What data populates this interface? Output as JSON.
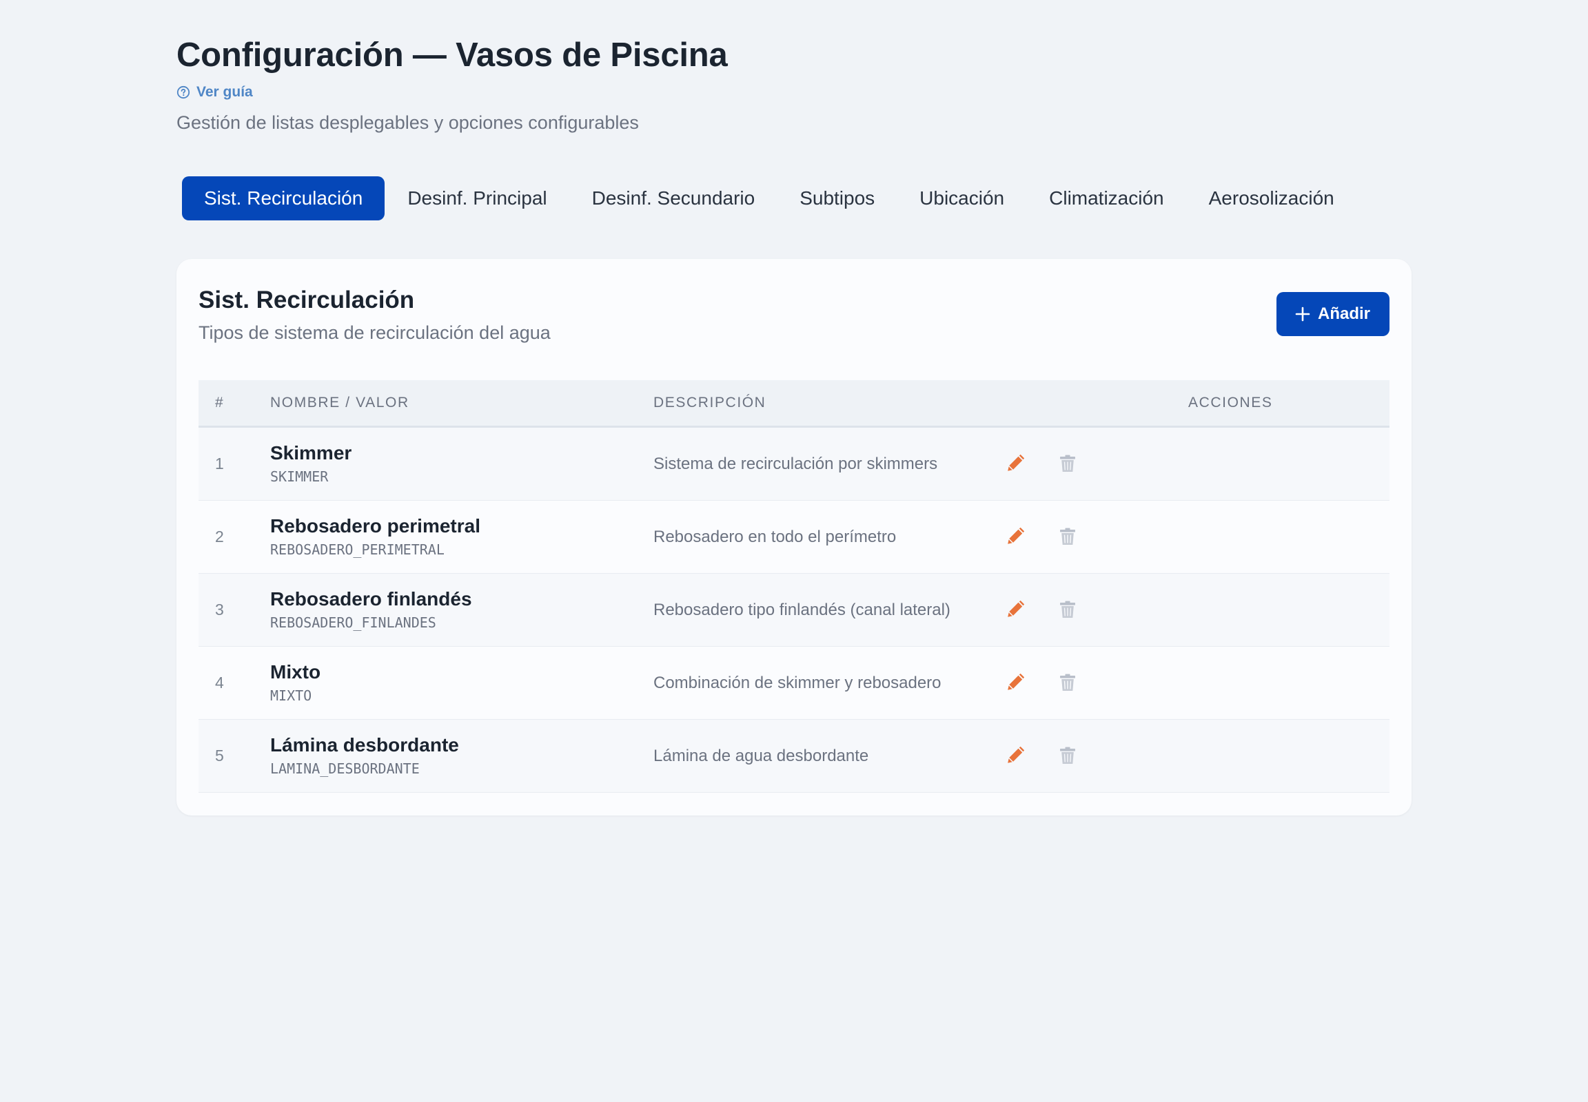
{
  "header": {
    "title": "Configuración — Vasos de Piscina",
    "guide_link": "Ver guía",
    "subtitle": "Gestión de listas desplegables y opciones configurables"
  },
  "tabs": [
    {
      "label": "Sist. Recirculación",
      "active": true
    },
    {
      "label": "Desinf. Principal",
      "active": false
    },
    {
      "label": "Desinf. Secundario",
      "active": false
    },
    {
      "label": "Subtipos",
      "active": false
    },
    {
      "label": "Ubicación",
      "active": false
    },
    {
      "label": "Climatización",
      "active": false
    },
    {
      "label": "Aerosolización",
      "active": false
    }
  ],
  "panel": {
    "title": "Sist. Recirculación",
    "subtitle": "Tipos de sistema de recirculación del agua",
    "add_label": "Añadir"
  },
  "table": {
    "columns": [
      "#",
      "NOMBRE / VALOR",
      "DESCRIPCIÓN",
      "ACCIONES"
    ],
    "rows": [
      {
        "num": "1",
        "label": "Skimmer",
        "value": "SKIMMER",
        "description": "Sistema de recirculación por skimmers"
      },
      {
        "num": "2",
        "label": "Rebosadero perimetral",
        "value": "REBOSADERO_PERIMETRAL",
        "description": "Rebosadero en todo el perímetro"
      },
      {
        "num": "3",
        "label": "Rebosadero finlandés",
        "value": "REBOSADERO_FINLANDES",
        "description": "Rebosadero tipo finlandés (canal lateral)"
      },
      {
        "num": "4",
        "label": "Mixto",
        "value": "MIXTO",
        "description": "Combinación de skimmer y rebosadero"
      },
      {
        "num": "5",
        "label": "Lámina desbordante",
        "value": "LAMINA_DESBORDANTE",
        "description": "Lámina de agua desbordante"
      }
    ]
  },
  "icons": {
    "guide": "help-circle-icon",
    "add": "plus-icon",
    "edit": "pencil-icon",
    "delete": "trash-icon"
  },
  "colors": {
    "primary": "#0547b8",
    "link": "#4f86c6",
    "edit_icon": "#e8733a",
    "delete_icon": "#b9bfca"
  }
}
